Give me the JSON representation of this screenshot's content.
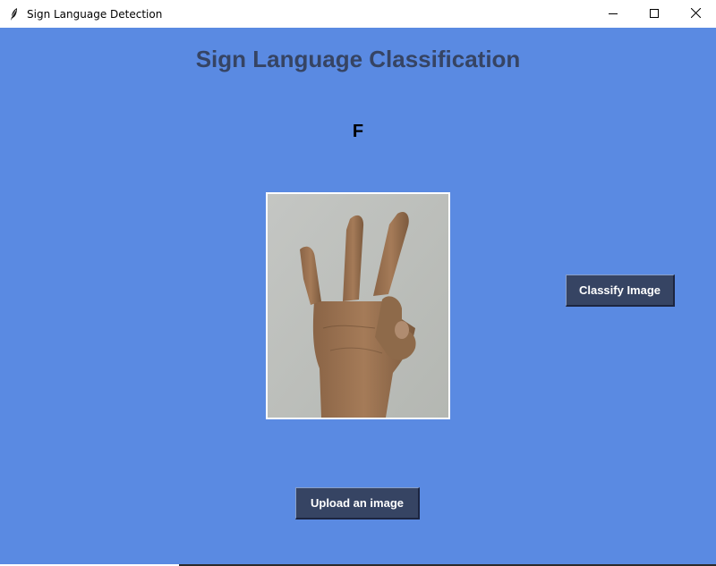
{
  "window": {
    "title": "Sign Language Detection",
    "app_icon": "feather-icon",
    "controls": [
      "minimize-icon",
      "maximize-icon",
      "close-icon"
    ]
  },
  "main": {
    "heading": "Sign Language Classification",
    "result_label": "F",
    "image_alt_icon": "hand-sign-image"
  },
  "buttons": {
    "classify_label": "Classify Image",
    "upload_label": "Upload an image"
  },
  "colors": {
    "background": "#5a8ae2",
    "heading": "#364463",
    "button_bg": "#364463",
    "button_text": "#ffffff"
  }
}
